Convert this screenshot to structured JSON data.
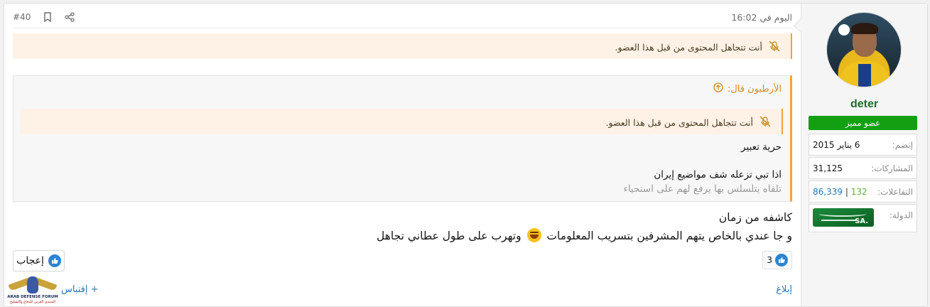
{
  "post": {
    "number": "#40",
    "timestamp": "اليوم في 16:02",
    "ignored_notice": "أنت تتجاهل المحتوى من قبل هذا العضو.",
    "quote": {
      "author_line": "الأرطبون قال:",
      "ignored_notice": "أنت تتجاهل المحتوى من قبل هذا العضو.",
      "lines": [
        "حرية تعبير",
        "اذا تبي تزعله شف مواضيع إيران"
      ],
      "faded_line": "تلقاه يتلسلس بها يرفع لهم على استحياء"
    },
    "body": {
      "line1": "كاشفه من زمان",
      "line2_before": "و جا عندي بالخاص يتهم المشرفين بتسريب المعلومات",
      "emoji": "joy-emoji",
      "line2_after": "وتهرب على طول عطاني تجاهل"
    },
    "reaction_count": "3",
    "like_button": "إعجاب",
    "quote_button": "+ إقتباس",
    "report_link": "إبلاغ"
  },
  "user": {
    "username": "deter",
    "role": "عضو مميز",
    "joined_label": "إنضم:",
    "joined_value": "6 يناير 2015",
    "posts_label": "المشاركات:",
    "posts_value": "31,125",
    "reactions_label": "التفاعلات:",
    "reactions_likes": "86,339",
    "reactions_separator": "|",
    "reactions_points": "132",
    "country_label": "الدولة:",
    "flag_text": ".SA"
  },
  "logo": {
    "line1": "ARAB DEFENSE FORUM",
    "line2": "المنتدى العربي للدفاع والتسليح"
  },
  "colors": {
    "accent": "#f0a33b",
    "link": "#2577b1",
    "role_badge": "#12a012",
    "username": "#1d6b2a"
  }
}
